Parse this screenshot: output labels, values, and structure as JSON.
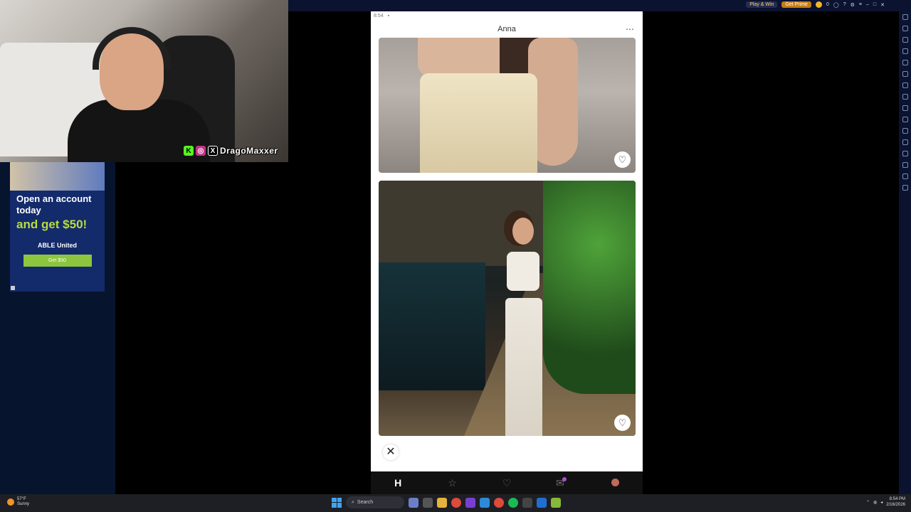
{
  "stream_overlay": {
    "handle": "DragoMaxxer",
    "social_icons": [
      "kick-icon",
      "instagram-icon",
      "x-icon"
    ]
  },
  "ad": {
    "headline": "Open an account today",
    "subline": "and get $50!",
    "brand": "ABLE United",
    "cta": "Get $50"
  },
  "emulator": {
    "play_win": "Play & Win",
    "get_prime": "Get Prime",
    "coins": "0"
  },
  "app": {
    "status_time": "8:54",
    "profile_name": "Anna",
    "more_label": "⋯",
    "close_label": "✕",
    "like_label": "♡",
    "nav": [
      {
        "icon": "hinge-home-icon",
        "glyph": "H"
      },
      {
        "icon": "star-icon",
        "glyph": "☆"
      },
      {
        "icon": "heart-icon",
        "glyph": "♡"
      },
      {
        "icon": "chat-icon",
        "glyph": "✉"
      },
      {
        "icon": "profile-avatar-icon",
        "glyph": ""
      }
    ]
  },
  "taskbar": {
    "temperature": "57°F",
    "condition": "Sunny",
    "search_placeholder": "Search",
    "time": "8:54 PM",
    "date": "2/16/2026"
  },
  "colors": {
    "app_bg": "#ffffff",
    "navbar_bg": "#111111",
    "emulator_chrome": "#0b1330",
    "ad_bg": "#132a6b",
    "ad_accent": "#b6dd3e",
    "taskbar_bg": "#1e1f24"
  }
}
